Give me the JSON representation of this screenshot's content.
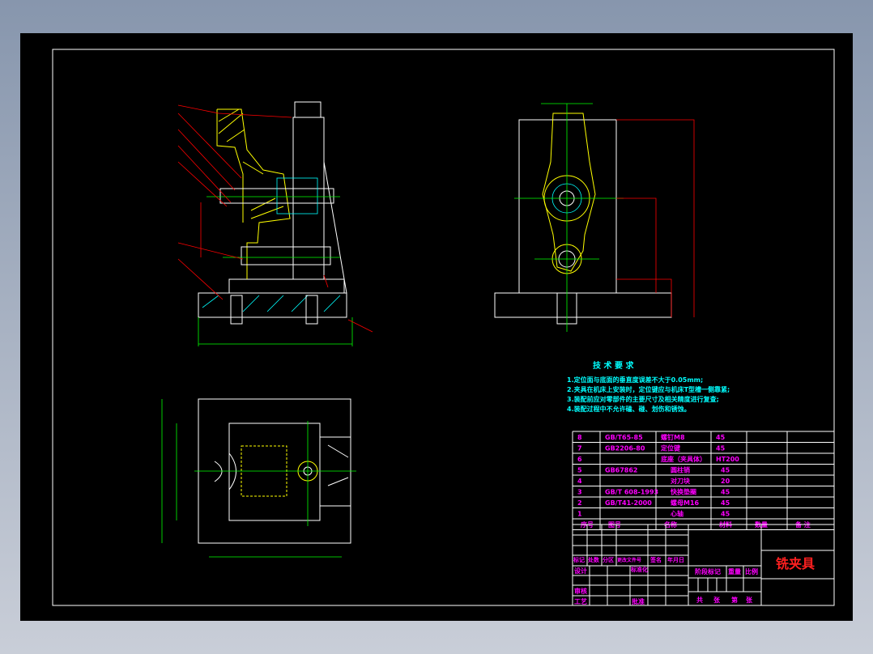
{
  "drawing_title": "铣夹具",
  "tech_requirements": {
    "heading": "技 术 要 求",
    "items": [
      "1.定位面与底面的垂直度误差不大于0.05mm;",
      "2.夹具在机床上安装时，定位键应与机床T型槽一侧靠紧;",
      "3.装配前应对零部件的主要尺寸及相关精度进行复查;",
      "4.装配过程中不允许磕、碰、划伤和锈蚀。"
    ]
  },
  "parts_list": {
    "rows": [
      [
        "8",
        "GB/T65-85",
        "螺钉M8",
        "45"
      ],
      [
        "7",
        "GB2206-80",
        "定位键",
        "45"
      ],
      [
        "6",
        "",
        "底座（夹具体）",
        "HT200"
      ],
      [
        "5",
        "GB67862",
        "圆柱销",
        "45"
      ],
      [
        "4",
        "",
        "对刀块",
        "20"
      ],
      [
        "3",
        "GB/T 608-1993",
        "快换垫圈",
        "45"
      ],
      [
        "2",
        "GB/T41-2000",
        "螺母M16",
        "45"
      ],
      [
        "1",
        "",
        "心轴",
        "45"
      ]
    ],
    "header": [
      "序号",
      "图号",
      "名称",
      "材料",
      "数量",
      "备 注"
    ]
  },
  "title_block": {
    "labels_row": [
      "标记",
      "处数",
      "分区",
      "更改文件号",
      "签名",
      "年月日"
    ],
    "design": "设计",
    "standardize": "标准化",
    "review": "审核",
    "process": "工艺",
    "approve": "批准",
    "stage_mark": "阶段标记",
    "weight": "重量",
    "scale": "比例",
    "sheets": [
      "共",
      "张",
      "第",
      "张"
    ]
  },
  "colors": {
    "background": "#000000",
    "frame": "#ffffff",
    "text_tech": "#00ffff",
    "text_table": "#ff00ff",
    "title": "#ff2020",
    "hatch": "#ffff00",
    "centerline": "#00ff00",
    "leader": "#ff0000"
  }
}
